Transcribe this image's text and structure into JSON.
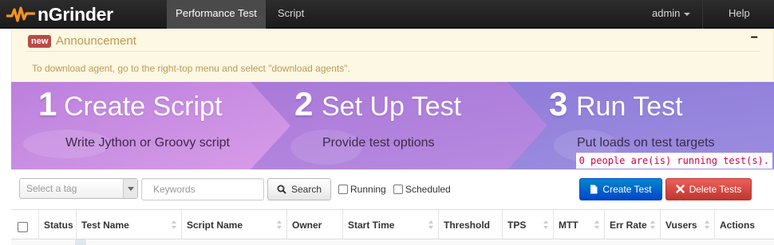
{
  "navbar": {
    "brand": "nGrinder",
    "items": [
      {
        "label": "Performance Test",
        "active": true
      },
      {
        "label": "Script",
        "active": false
      }
    ],
    "user": "admin",
    "help": "Help"
  },
  "announcement": {
    "badge": "new",
    "title": "Announcement",
    "collapse": "−",
    "body": "To download agent, go to the right-top menu and select \"download agents\"."
  },
  "banner": {
    "steps": [
      {
        "num": "1",
        "title": "Create Script",
        "subtitle": "Write Jython or Groovy script"
      },
      {
        "num": "2",
        "title": "Set Up Test",
        "subtitle": "Provide test options"
      },
      {
        "num": "3",
        "title": "Run Test",
        "subtitle": "Put loads on test targets"
      }
    ],
    "running_message": "0 people are(is) running test(s).",
    "colors": {
      "step1": "#c58ee0",
      "step2": "#a77ad8",
      "step3": "#8f7fd9"
    }
  },
  "toolbar": {
    "tag_placeholder": "Select a tag",
    "keyword_placeholder": "Keywords",
    "search_label": "Search",
    "running_label": "Running",
    "scheduled_label": "Scheduled",
    "create_label": "Create Test",
    "delete_label": "Delete Tests"
  },
  "table": {
    "columns": [
      "Status",
      "Test Name",
      "Script Name",
      "Owner",
      "Start Time",
      "Threshold",
      "TPS",
      "MTT",
      "Err Rate",
      "Vusers",
      "Actions"
    ]
  },
  "theme": {
    "accent_create": "#0074cc",
    "accent_delete": "#da4f49",
    "announce_bg": "#fcf8e3",
    "announce_text": "#c09853"
  }
}
